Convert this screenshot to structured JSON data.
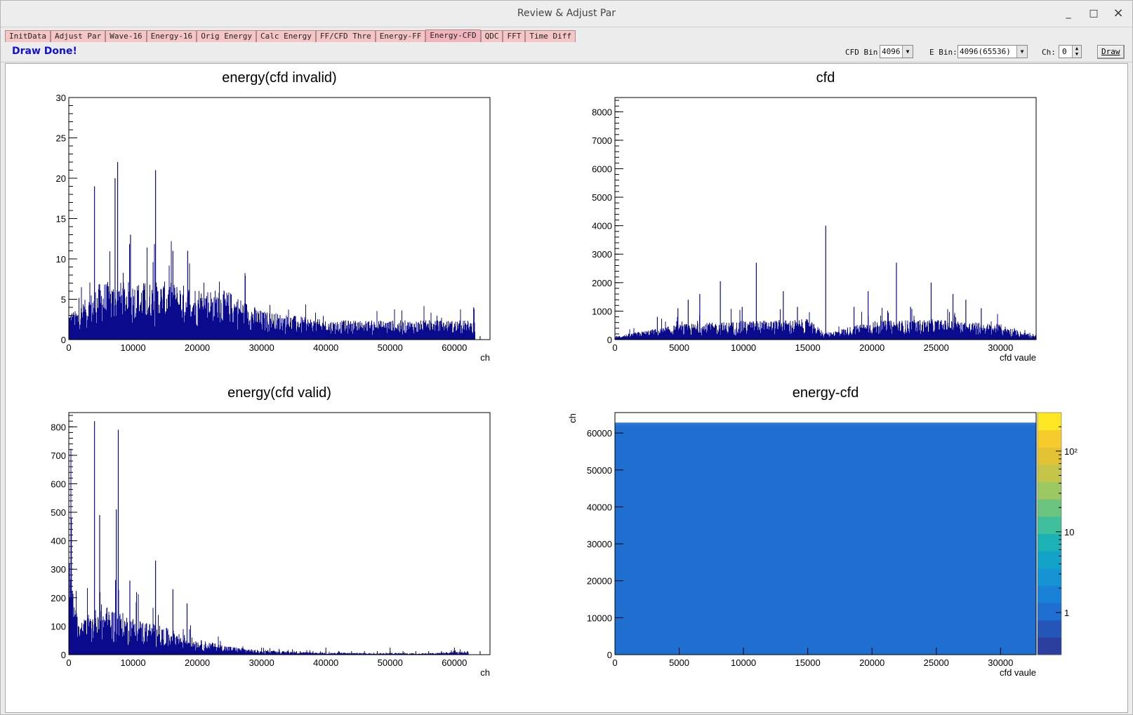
{
  "window": {
    "title": "Review & Adjust Par",
    "minimize_glyph": "_",
    "maximize_glyph": "□",
    "close_glyph": "×"
  },
  "tabs": [
    {
      "label": "InitData",
      "active": false
    },
    {
      "label": "Adjust Par",
      "active": false
    },
    {
      "label": "Wave-16",
      "active": false
    },
    {
      "label": "Energy-16",
      "active": false
    },
    {
      "label": "Orig Energy",
      "active": false
    },
    {
      "label": "Calc Energy",
      "active": false
    },
    {
      "label": "FF/CFD Thre",
      "active": false
    },
    {
      "label": "Energy-FF",
      "active": false
    },
    {
      "label": "Energy-CFD",
      "active": true
    },
    {
      "label": "QDC",
      "active": false
    },
    {
      "label": "FFT",
      "active": false
    },
    {
      "label": "Time Diff",
      "active": false
    }
  ],
  "toolbar": {
    "status": "Draw Done!",
    "cfd_bin_label": "CFD Bin:",
    "cfd_bin_value": "4096",
    "e_bin_label": "E Bin:",
    "e_bin_value": "4096(65536)",
    "ch_label": "Ch:",
    "ch_value": "0",
    "draw_label": "Draw"
  },
  "colors": {
    "hist_line": "#0a0a8c",
    "tab_bg": "#f5c6c6",
    "status_text": "#1010d8"
  },
  "chart_data": [
    {
      "type": "bar",
      "title": "energy(cfd invalid)",
      "xlabel": "ch",
      "ylabel": "",
      "xlim": [
        0,
        65536
      ],
      "ylim": [
        0,
        30
      ],
      "xticks": [
        0,
        10000,
        20000,
        30000,
        40000,
        50000,
        60000
      ],
      "yticks": [
        0,
        5,
        10,
        15,
        20,
        25,
        30
      ],
      "peaks": [
        {
          "x": 4000,
          "y": 19
        },
        {
          "x": 7200,
          "y": 20
        },
        {
          "x": 7600,
          "y": 22
        },
        {
          "x": 9600,
          "y": 13
        },
        {
          "x": 13500,
          "y": 21
        },
        {
          "x": 16200,
          "y": 11
        },
        {
          "x": 18500,
          "y": 11
        },
        {
          "x": 63000,
          "y": 4
        }
      ],
      "baseline": [
        {
          "x": 1000,
          "y": 3
        },
        {
          "x": 5000,
          "y": 6
        },
        {
          "x": 15000,
          "y": 6
        },
        {
          "x": 25000,
          "y": 5
        },
        {
          "x": 30000,
          "y": 3
        },
        {
          "x": 40000,
          "y": 2
        },
        {
          "x": 55000,
          "y": 2
        },
        {
          "x": 63000,
          "y": 2
        }
      ]
    },
    {
      "type": "bar",
      "title": "cfd",
      "xlabel": "cfd vaule",
      "ylabel": "",
      "xlim": [
        0,
        32768
      ],
      "ylim": [
        0,
        8500
      ],
      "xticks": [
        0,
        5000,
        10000,
        15000,
        20000,
        25000,
        30000
      ],
      "yticks": [
        0,
        1000,
        2000,
        3000,
        4000,
        5000,
        6000,
        7000,
        8000
      ],
      "peaks": [
        {
          "x": 3300,
          "y": 800
        },
        {
          "x": 4900,
          "y": 1100
        },
        {
          "x": 5700,
          "y": 1400
        },
        {
          "x": 6600,
          "y": 1600
        },
        {
          "x": 8200,
          "y": 2050
        },
        {
          "x": 9900,
          "y": 1150
        },
        {
          "x": 11000,
          "y": 2700
        },
        {
          "x": 13100,
          "y": 1700
        },
        {
          "x": 14200,
          "y": 1150
        },
        {
          "x": 16400,
          "y": 4000
        },
        {
          "x": 18600,
          "y": 1150
        },
        {
          "x": 19700,
          "y": 1700
        },
        {
          "x": 21900,
          "y": 2700
        },
        {
          "x": 23000,
          "y": 1150
        },
        {
          "x": 24600,
          "y": 2000
        },
        {
          "x": 26300,
          "y": 1600
        },
        {
          "x": 27300,
          "y": 1400
        },
        {
          "x": 28500,
          "y": 1100
        }
      ],
      "baseline": [
        {
          "x": 0,
          "y": 100
        },
        {
          "x": 5000,
          "y": 450
        },
        {
          "x": 10000,
          "y": 550
        },
        {
          "x": 15000,
          "y": 600
        },
        {
          "x": 16400,
          "y": 200
        },
        {
          "x": 20000,
          "y": 550
        },
        {
          "x": 25000,
          "y": 600
        },
        {
          "x": 30000,
          "y": 450
        },
        {
          "x": 32700,
          "y": 100
        }
      ]
    },
    {
      "type": "bar",
      "title": "energy(cfd valid)",
      "xlabel": "ch",
      "ylabel": "",
      "xlim": [
        0,
        65536
      ],
      "ylim": [
        0,
        850
      ],
      "xticks": [
        0,
        10000,
        20000,
        30000,
        40000,
        50000,
        60000
      ],
      "yticks": [
        0,
        100,
        200,
        300,
        400,
        500,
        600,
        700,
        800
      ],
      "peaks": [
        {
          "x": 400,
          "y": 480
        },
        {
          "x": 4000,
          "y": 820
        },
        {
          "x": 4800,
          "y": 490
        },
        {
          "x": 7400,
          "y": 510
        },
        {
          "x": 7700,
          "y": 790
        },
        {
          "x": 9500,
          "y": 260
        },
        {
          "x": 13500,
          "y": 330
        },
        {
          "x": 16200,
          "y": 230
        },
        {
          "x": 18400,
          "y": 180
        }
      ],
      "baseline": [
        {
          "x": 0,
          "y": 420
        },
        {
          "x": 1500,
          "y": 90
        },
        {
          "x": 5000,
          "y": 150
        },
        {
          "x": 10000,
          "y": 110
        },
        {
          "x": 15000,
          "y": 80
        },
        {
          "x": 20000,
          "y": 45
        },
        {
          "x": 25000,
          "y": 25
        },
        {
          "x": 30000,
          "y": 12
        },
        {
          "x": 40000,
          "y": 6
        },
        {
          "x": 55000,
          "y": 4
        },
        {
          "x": 62000,
          "y": 10
        }
      ]
    },
    {
      "type": "heatmap",
      "title": "energy-cfd",
      "xlabel": "cfd vaule",
      "ylabel": "ch",
      "xlim": [
        0,
        32768
      ],
      "ylim": [
        0,
        65536
      ],
      "xticks": [
        0,
        5000,
        10000,
        15000,
        20000,
        25000,
        30000
      ],
      "yticks": [
        0,
        10000,
        20000,
        30000,
        40000,
        50000,
        60000
      ],
      "zscale": "log",
      "zticks": [
        {
          "value": 1,
          "label": "1"
        },
        {
          "value": 10,
          "label": "10"
        },
        {
          "value": 100,
          "label": "10²"
        }
      ],
      "density_profile": [
        {
          "y": 0,
          "fill": 1.0
        },
        {
          "y": 25000,
          "fill": 1.0
        },
        {
          "y": 35000,
          "fill": 0.85
        },
        {
          "y": 45000,
          "fill": 0.55
        },
        {
          "y": 55000,
          "fill": 0.35
        },
        {
          "y": 62000,
          "fill": 0.5
        },
        {
          "y": 62800,
          "fill": 0.0
        }
      ]
    }
  ]
}
